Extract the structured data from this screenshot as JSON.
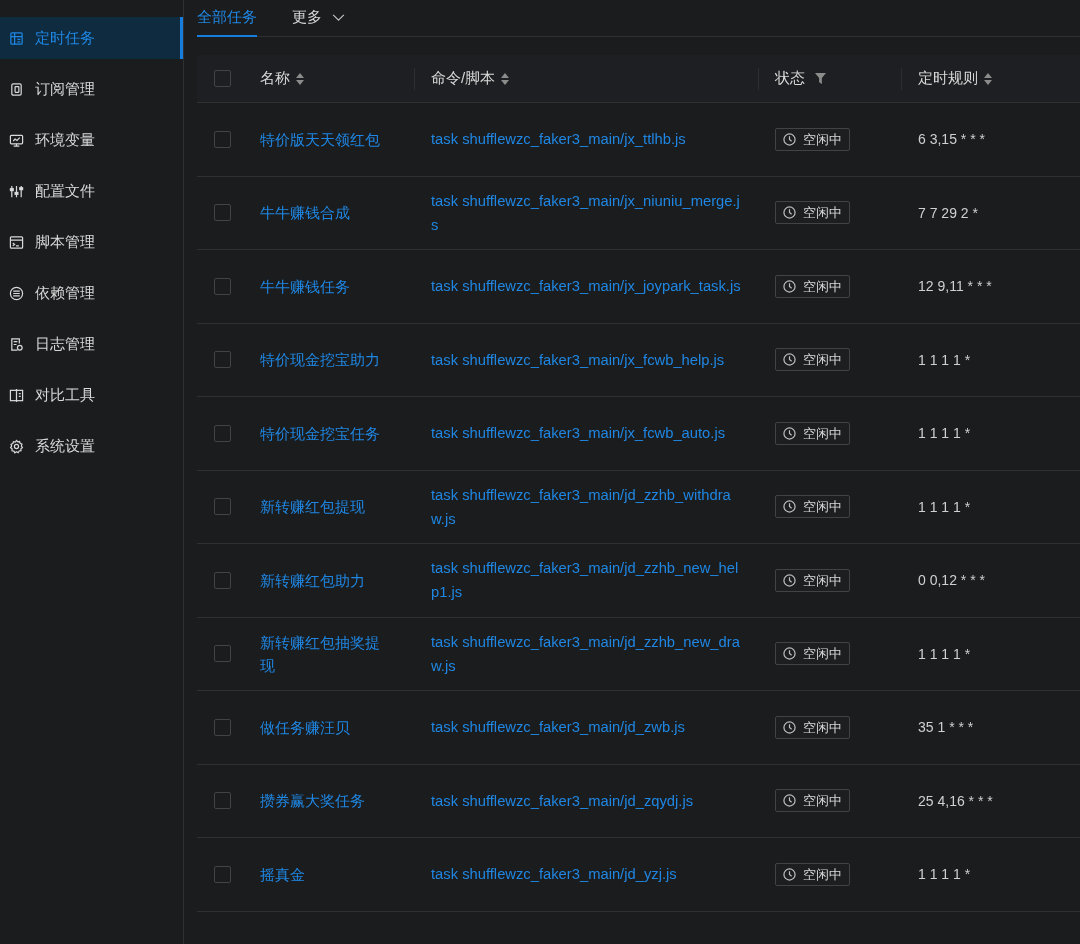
{
  "sidebar": {
    "items": [
      {
        "label": "定时任务",
        "selected": true
      },
      {
        "label": "订阅管理",
        "selected": false
      },
      {
        "label": "环境变量",
        "selected": false
      },
      {
        "label": "配置文件",
        "selected": false
      },
      {
        "label": "脚本管理",
        "selected": false
      },
      {
        "label": "依赖管理",
        "selected": false
      },
      {
        "label": "日志管理",
        "selected": false
      },
      {
        "label": "对比工具",
        "selected": false
      },
      {
        "label": "系统设置",
        "selected": false
      }
    ]
  },
  "tabs": [
    {
      "label": "全部任务",
      "selected": true,
      "kind": "plain"
    },
    {
      "label": "更多",
      "selected": false,
      "kind": "dropdown"
    }
  ],
  "table": {
    "header_checkbox": {
      "checked": false
    },
    "columns": [
      {
        "label": "名称",
        "kind": "sort"
      },
      {
        "label": "命令/脚本",
        "kind": "sort"
      },
      {
        "label": "状态",
        "kind": "filter"
      },
      {
        "label": "定时规则",
        "kind": "sort"
      }
    ],
    "rows": [
      {
        "checked": false,
        "name": "特价版天天领红包",
        "command": "task shufflewzc_faker3_main/jx_ttlhb.js",
        "status": "空闲中",
        "schedule": "6 3,15 * * *"
      },
      {
        "checked": false,
        "name": "牛牛赚钱合成",
        "command": "task shufflewzc_faker3_main/jx_niuniu_merge.js",
        "status": "空闲中",
        "schedule": "7 7 29 2 *"
      },
      {
        "checked": false,
        "name": "牛牛赚钱任务",
        "command": "task shufflewzc_faker3_main/jx_joypark_task.js",
        "status": "空闲中",
        "schedule": "12 9,11 * * *"
      },
      {
        "checked": false,
        "name": "特价现金挖宝助力",
        "command": "task shufflewzc_faker3_main/jx_fcwb_help.js",
        "status": "空闲中",
        "schedule": "1 1 1 1 *"
      },
      {
        "checked": false,
        "name": "特价现金挖宝任务",
        "command": "task shufflewzc_faker3_main/jx_fcwb_auto.js",
        "status": "空闲中",
        "schedule": "1 1 1 1 *"
      },
      {
        "checked": false,
        "name": "新转赚红包提现",
        "command": "task shufflewzc_faker3_main/jd_zzhb_withdraw.js",
        "status": "空闲中",
        "schedule": "1 1 1 1 *"
      },
      {
        "checked": false,
        "name": "新转赚红包助力",
        "command": "task shufflewzc_faker3_main/jd_zzhb_new_help1.js",
        "status": "空闲中",
        "schedule": "0 0,12 * * *"
      },
      {
        "checked": false,
        "name": "新转赚红包抽奖提现",
        "command": "task shufflewzc_faker3_main/jd_zzhb_new_draw.js",
        "status": "空闲中",
        "schedule": "1 1 1 1 *"
      },
      {
        "checked": false,
        "name": "做任务赚汪贝",
        "command": "task shufflewzc_faker3_main/jd_zwb.js",
        "status": "空闲中",
        "schedule": "35 1 * * *"
      },
      {
        "checked": false,
        "name": "攒券赢大奖任务",
        "command": "task shufflewzc_faker3_main/jd_zqydj.js",
        "status": "空闲中",
        "schedule": "25 4,16 * * *"
      },
      {
        "checked": false,
        "name": "摇真金",
        "command": "task shufflewzc_faker3_main/jd_yzj.js",
        "status": "空闲中",
        "schedule": "1 1 1 1 *"
      }
    ]
  }
}
